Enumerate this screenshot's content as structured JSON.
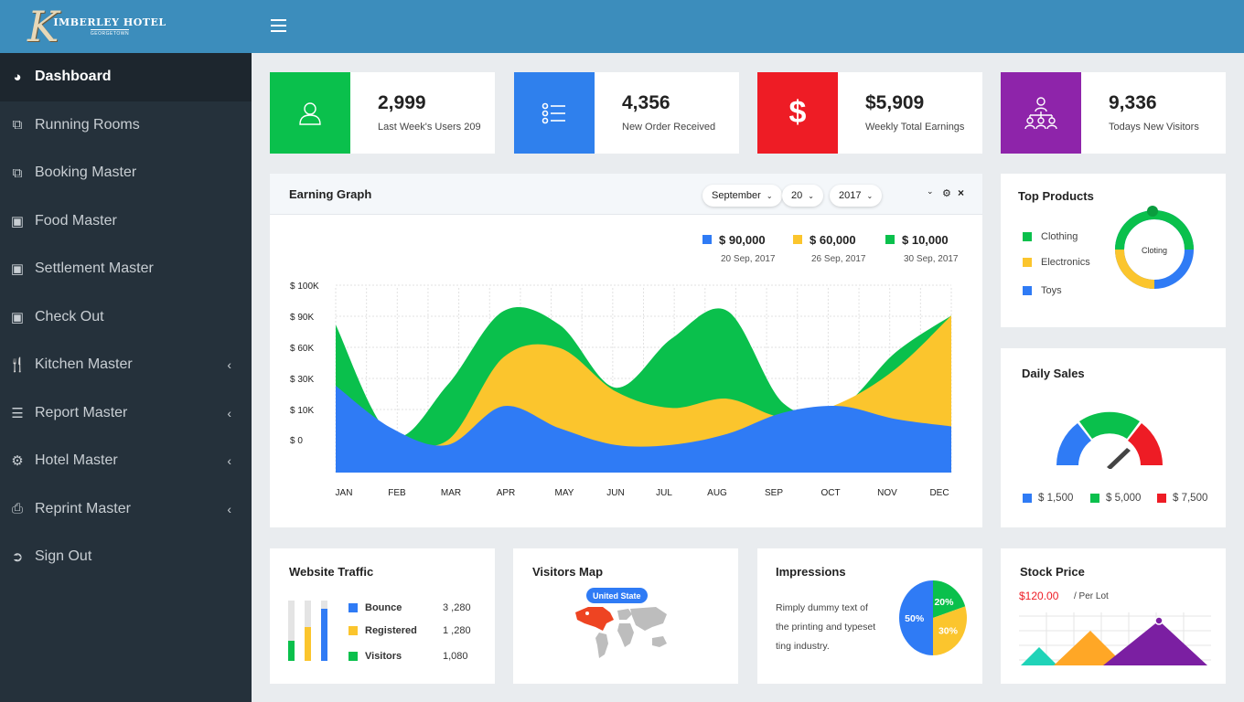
{
  "brand": {
    "monogram": "K",
    "name": "IMBERLEY HOTEL",
    "sub": "GEORGETOWN"
  },
  "sidebar": {
    "items": [
      {
        "label": "Dashboard",
        "icon": "dashboard-icon"
      },
      {
        "label": "Running Rooms",
        "icon": "copy-icon"
      },
      {
        "label": "Booking Master",
        "icon": "copy-icon"
      },
      {
        "label": "Food Master",
        "icon": "money-icon"
      },
      {
        "label": "Settlement Master",
        "icon": "money-icon"
      },
      {
        "label": "Check Out",
        "icon": "money-icon"
      },
      {
        "label": "Kitchen Master",
        "icon": "cutlery-icon"
      },
      {
        "label": "Report Master",
        "icon": "list-icon"
      },
      {
        "label": "Hotel Master",
        "icon": "cogs-icon"
      },
      {
        "label": "Reprint Master",
        "icon": "print-icon"
      },
      {
        "label": "Sign Out",
        "icon": "sign-out-icon"
      }
    ]
  },
  "stats": [
    {
      "value": "2,999",
      "label": "Last Week's Users 209",
      "color": "#0ac04c",
      "icon": "users-icon"
    },
    {
      "value": "4,356",
      "label": "New Order Received",
      "color": "#2f80ed",
      "icon": "checklist-icon"
    },
    {
      "value": "$5,909",
      "label": "Weekly Total Earnings",
      "color": "#ee1c25",
      "icon": "dollar-icon",
      "glyph": "$"
    },
    {
      "value": "9,336",
      "label": "Todays New Visitors",
      "color": "#8e24aa",
      "icon": "network-icon"
    }
  ],
  "earning": {
    "title": "Earning Graph",
    "month": "September",
    "day": "20",
    "year": "2017",
    "legend": [
      {
        "value": "$ 90,000",
        "date": "20 Sep, 2017",
        "color": "#2f7bf5"
      },
      {
        "value": "$ 60,000",
        "date": "26 Sep, 2017",
        "color": "#fbc52d"
      },
      {
        "value": "$ 10,000",
        "date": "30 Sep, 2017",
        "color": "#0ac04c"
      }
    ]
  },
  "chart_data": {
    "type": "area",
    "categories": [
      "JAN",
      "FEB",
      "MAR",
      "APR",
      "MAY",
      "JUN",
      "JUL",
      "AUG",
      "SEP",
      "OCT",
      "NOV",
      "DEC"
    ],
    "y_tick_labels": [
      "$ 100K",
      "$ 90K",
      "$ 60K",
      "$ 30K",
      "$ 10K",
      "$ 0"
    ],
    "grid": true,
    "series": [
      {
        "color": "#2f7bf5",
        "values": [
          94,
          48,
          30,
          72,
          48,
          30,
          30,
          42,
          65,
          72,
          58,
          50
        ]
      },
      {
        "color": "#fbc52d",
        "values": [
          90,
          42,
          35,
          125,
          135,
          88,
          70,
          80,
          60,
          75,
          112,
          170
        ]
      },
      {
        "color": "#0ac04c",
        "values": [
          160,
          40,
          95,
          175,
          160,
          92,
          145,
          175,
          75,
          70,
          130,
          170
        ]
      }
    ]
  },
  "top_products": {
    "title": "Top Products",
    "items": [
      {
        "label": "Clothing",
        "color": "#0ac04c"
      },
      {
        "label": "Electronics",
        "color": "#fbc52d"
      },
      {
        "label": "Toys",
        "color": "#2f7bf5"
      }
    ],
    "center": "Cloting"
  },
  "daily_sales": {
    "title": "Daily Sales",
    "items": [
      {
        "label": "$ 1,500",
        "color": "#2f7bf5"
      },
      {
        "label": "$ 5,000",
        "color": "#0ac04c"
      },
      {
        "label": "$ 7,500",
        "color": "#ee1c25"
      }
    ]
  },
  "traffic": {
    "title": "Website Traffic",
    "items": [
      {
        "label": "Bounce",
        "value": "3 ,280",
        "color": "#2f7bf5",
        "level": 0.86
      },
      {
        "label": "Registered",
        "value": "1 ,280",
        "color": "#fbc52d",
        "level": 0.56
      },
      {
        "label": "Visitors",
        "value": "1,080",
        "color": "#0ac04c",
        "level": 0.33
      }
    ]
  },
  "visitors_map": {
    "title": "Visitors Map",
    "badge": "United State"
  },
  "impressions": {
    "title": "Impressions",
    "lines": [
      "Rimply dummy text of",
      "the printing and typeset",
      "ting industry."
    ],
    "pie": [
      {
        "label": "50%",
        "value": 50,
        "color": "#2f7bf5"
      },
      {
        "label": "20%",
        "value": 20,
        "color": "#0ac04c"
      },
      {
        "label": "30%",
        "value": 30,
        "color": "#fbc52d"
      }
    ]
  },
  "stock": {
    "title": "Stock Price",
    "price": "$120.00",
    "unit": "/ Per Lot",
    "price_color": "#ee1c25"
  }
}
